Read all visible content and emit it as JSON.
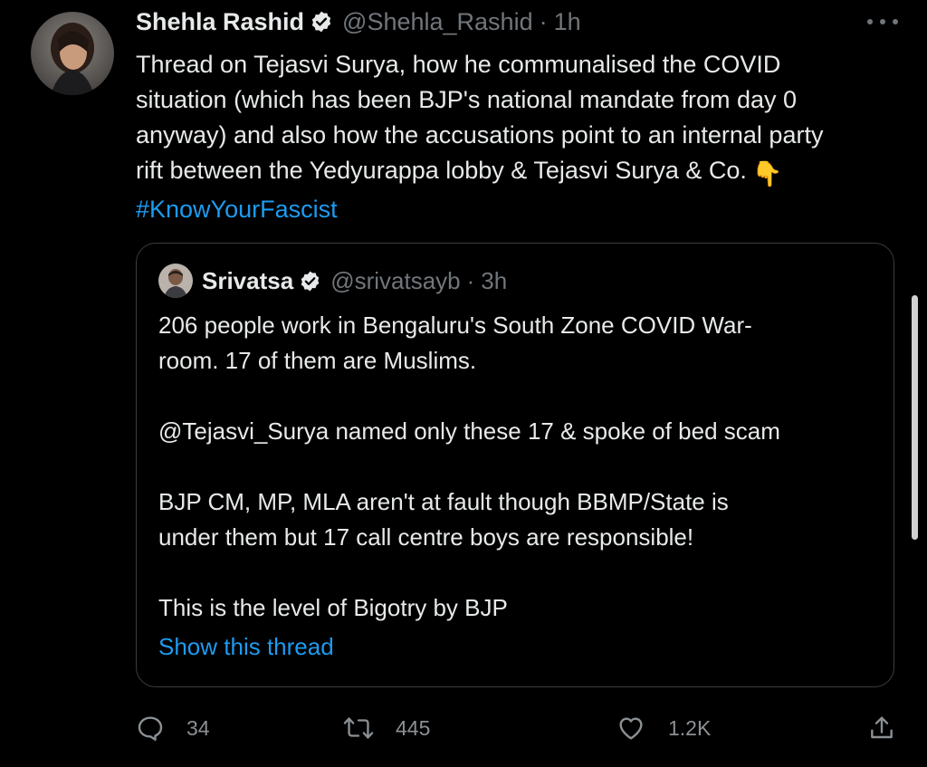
{
  "tweet": {
    "author": {
      "name": "Shehla Rashid",
      "handle": "@Shehla_Rashid",
      "time": "1h"
    },
    "separator": "·",
    "text_lines": [
      "Thread on Tejasvi Surya, how he communalised the COVID",
      "situation (which has been BJP's national mandate from day 0",
      "anyway) and also how the accusations point to an internal party",
      "rift between the Yedyurappa lobby & Tejasvi Surya & Co."
    ],
    "emoji": "👇",
    "hashtag": "#KnowYourFascist",
    "more_icon": "more-horizontal-icon"
  },
  "quote": {
    "author": {
      "name": "Srivatsa",
      "handle": "@srivatsayb",
      "time": "3h"
    },
    "separator": "·",
    "text_lines": [
      "206 people work in Bengaluru's South Zone COVID War-",
      "room. 17 of them are Muslims.",
      "",
      "@Tejasvi_Surya named only these 17 & spoke of bed scam",
      "",
      "BJP CM, MP, MLA aren't at fault though BBMP/State is",
      "under them but 17 call centre boys are responsible!",
      "",
      "This is the level of Bigotry by BJP"
    ],
    "show_thread": "Show this thread"
  },
  "actions": {
    "reply_count": "34",
    "retweet_count": "445",
    "like_count": "1.2K",
    "icons": [
      "reply-icon",
      "retweet-icon",
      "like-icon",
      "share-icon"
    ]
  },
  "colors": {
    "background": "#000000",
    "text": "#e7e9ea",
    "secondary": "#71767b",
    "link": "#1d9bf0",
    "border": "#3a3d40"
  }
}
